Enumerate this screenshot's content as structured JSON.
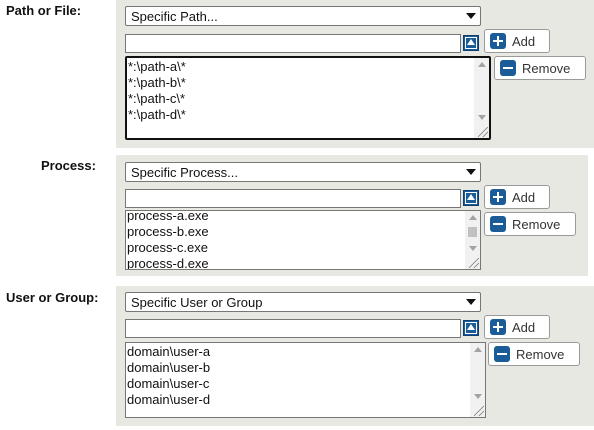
{
  "sections": [
    {
      "label": "Path or File:",
      "select_value": "Specific Path...",
      "input_value": "",
      "add_label": "Add",
      "remove_label": "Remove",
      "items": [
        "*:\\path-a\\*",
        "*:\\path-b\\*",
        "*:\\path-c\\*",
        "*:\\path-d\\*"
      ]
    },
    {
      "label": "Process:",
      "select_value": "Specific Process...",
      "input_value": "",
      "add_label": "Add",
      "remove_label": "Remove",
      "items": [
        "process-a.exe",
        "process-b.exe",
        "process-c.exe",
        "process-d.exe"
      ]
    },
    {
      "label": "User or Group:",
      "select_value": "Specific User or Group",
      "input_value": "",
      "add_label": "Add",
      "remove_label": "Remove",
      "items": [
        "domain\\user-a",
        "domain\\user-b",
        "domain\\user-c",
        "domain\\user-d"
      ]
    }
  ],
  "icons": {
    "add": "plus-icon",
    "remove": "minus-icon",
    "move_up": "arrow-up-icon"
  },
  "colors": {
    "panel_bg": "#e8e8e3",
    "icon_blue": "#1b5b97"
  }
}
